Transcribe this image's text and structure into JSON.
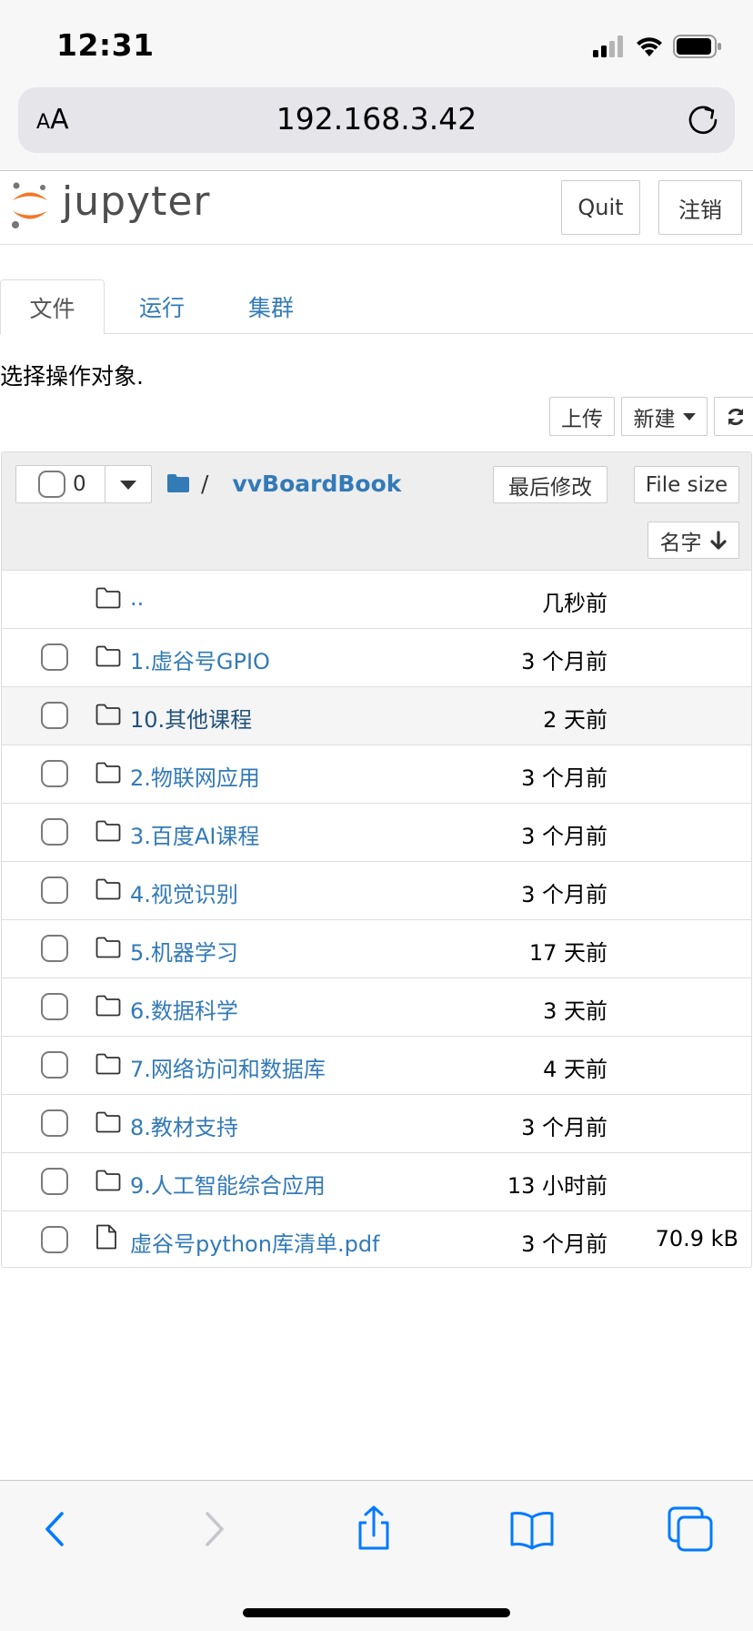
{
  "status_bar": {
    "time": "12:31",
    "icons": [
      "cellular-signal-icon",
      "wifi-icon",
      "battery-icon"
    ]
  },
  "browser": {
    "text_size_button": {
      "small": "A",
      "big": "A"
    },
    "url": "192.168.3.42",
    "reload_icon": "reload-icon"
  },
  "jupyter_header": {
    "logo_text": "jupyter",
    "quit_label": "Quit",
    "logout_label": "注销",
    "logo_colors": {
      "orange": "#f37726",
      "gray": "#767677"
    }
  },
  "tabs": [
    {
      "label": "文件",
      "active": true
    },
    {
      "label": "运行",
      "active": false
    },
    {
      "label": "集群",
      "active": false
    }
  ],
  "select_hint": "选择操作对象.",
  "toolbar": {
    "upload_label": "上传",
    "new_label": "新建",
    "refresh_icon": "refresh-icon"
  },
  "list_header": {
    "selected_count": "0",
    "breadcrumb_root": "/",
    "breadcrumb_current": "vvBoardBook",
    "sort_modified_label": "最后修改",
    "sort_size_label": "File size",
    "sort_name_label": "名字"
  },
  "rows": [
    {
      "name": "..",
      "modified": "几秒前",
      "size": "",
      "type": "parent"
    },
    {
      "name": "1.虚谷号GPIO",
      "modified": "3 个月前",
      "size": "",
      "type": "folder"
    },
    {
      "name": "10.其他课程",
      "modified": "2 天前",
      "size": "",
      "type": "folder"
    },
    {
      "name": "2.物联网应用",
      "modified": "3 个月前",
      "size": "",
      "type": "folder"
    },
    {
      "name": "3.百度AI课程",
      "modified": "3 个月前",
      "size": "",
      "type": "folder"
    },
    {
      "name": "4.视觉识别",
      "modified": "3 个月前",
      "size": "",
      "type": "folder"
    },
    {
      "name": "5.机器学习",
      "modified": "17 天前",
      "size": "",
      "type": "folder"
    },
    {
      "name": "6.数据科学",
      "modified": "3 天前",
      "size": "",
      "type": "folder"
    },
    {
      "name": "7.网络访问和数据库",
      "modified": "4 天前",
      "size": "",
      "type": "folder"
    },
    {
      "name": "8.教材支持",
      "modified": "3 个月前",
      "size": "",
      "type": "folder"
    },
    {
      "name": "9.人工智能综合应用",
      "modified": "13 小时前",
      "size": "",
      "type": "folder"
    },
    {
      "name": "虚谷号python库清单.pdf",
      "modified": "3 个月前",
      "size": "70.9 kB",
      "type": "file"
    }
  ],
  "bottom_toolbar": {
    "icons": [
      "back-icon",
      "forward-icon",
      "share-icon",
      "bookmarks-icon",
      "tabs-icon"
    ]
  },
  "colors": {
    "link": "#337ab7",
    "ios_blue": "#007aff",
    "panel_header_bg": "#eeeeee"
  }
}
